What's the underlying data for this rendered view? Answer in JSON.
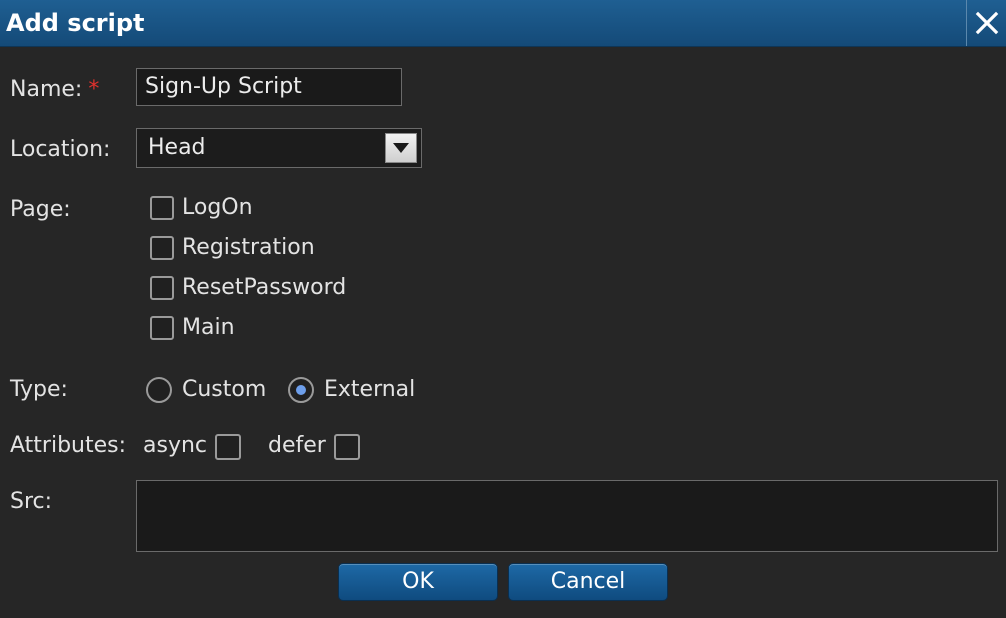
{
  "dialog": {
    "title": "Add script",
    "close_icon": "close-icon"
  },
  "form": {
    "name": {
      "label": "Name:",
      "required_mark": "*",
      "value": "Sign-Up Script"
    },
    "location": {
      "label": "Location:",
      "value": "Head",
      "arrow_icon": "chevron-down-icon"
    },
    "page": {
      "label": "Page:",
      "options": [
        {
          "label": "LogOn",
          "checked": false
        },
        {
          "label": "Registration",
          "checked": false
        },
        {
          "label": "ResetPassword",
          "checked": false
        },
        {
          "label": "Main",
          "checked": false
        }
      ]
    },
    "type": {
      "label": "Type:",
      "options": [
        {
          "label": "Custom",
          "selected": false
        },
        {
          "label": "External",
          "selected": true
        }
      ]
    },
    "attributes": {
      "label": "Attributes:",
      "async": {
        "label": "async",
        "checked": false
      },
      "defer": {
        "label": "defer",
        "checked": false
      }
    },
    "src": {
      "label": "Src:",
      "value": ""
    }
  },
  "buttons": {
    "ok": "OK",
    "cancel": "Cancel"
  },
  "colors": {
    "titlebar": "#1a5a8e",
    "background": "#262626",
    "required": "#e0312d",
    "radio_selected": "#6d9eea"
  }
}
